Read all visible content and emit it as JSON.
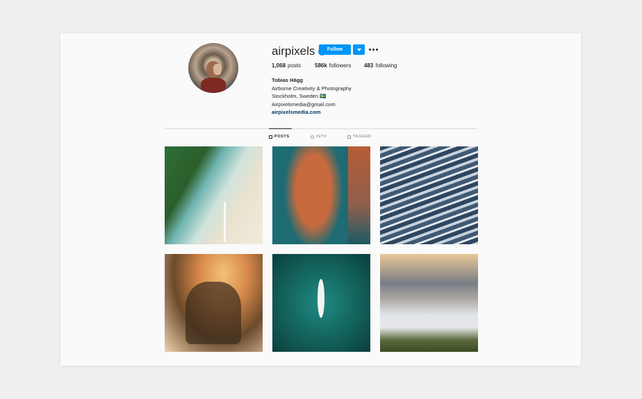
{
  "profile": {
    "username": "airpixels",
    "verified_glyph": "✓",
    "follow_label": "Follow",
    "stats": [
      {
        "value": "1,068",
        "label": "posts"
      },
      {
        "value": "586k",
        "label": "followers"
      },
      {
        "value": "483",
        "label": "following"
      }
    ],
    "bio": {
      "full_name": "Tobias Hägg",
      "line1": "Airborne Creativity & Photography",
      "line2": "Stockholm, Sweden 🇸🇪",
      "line3": "Airpixelsmedia@gmail.com",
      "link": "airpixelsmedia.com"
    }
  },
  "tabs": [
    {
      "label": "POSTS",
      "icon": "grid-icon",
      "active": true
    },
    {
      "label": "IGTV",
      "icon": "igtv-icon",
      "active": false
    },
    {
      "label": "TAGGED",
      "icon": "tagged-icon",
      "active": false
    }
  ],
  "posts": [
    {
      "subject": "palm-beach"
    },
    {
      "subject": "island-city"
    },
    {
      "subject": "glacial-river"
    },
    {
      "subject": "misty-mountains"
    },
    {
      "subject": "kayak"
    },
    {
      "subject": "mountain-peak"
    }
  ],
  "colors": {
    "accent": "#0095f6",
    "verified": "#3897f0",
    "link": "#003569"
  }
}
